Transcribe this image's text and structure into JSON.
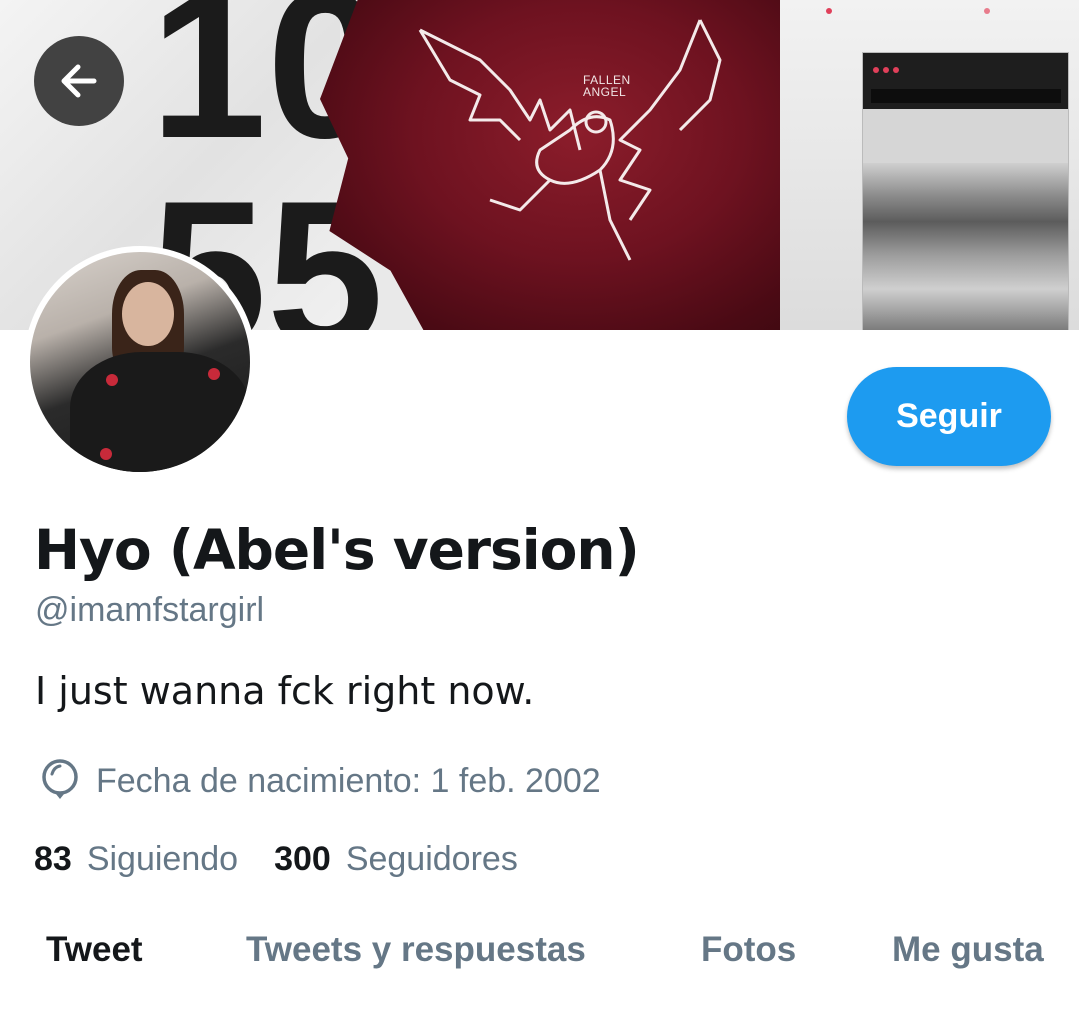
{
  "header": {
    "back_icon": "arrow-left-icon",
    "banner_text": "FALLEN ANGEL"
  },
  "profile": {
    "display_name": "Hyo (Abel's version)",
    "handle": "@imamfstargirl",
    "bio": "I just wanna fck right now.",
    "birth_icon": "balloon-icon",
    "birth_label": "Fecha de nacimiento: 1 feb. 2002",
    "follow_label": "Seguir"
  },
  "stats": {
    "following_count": "83",
    "following_label": "Siguiendo",
    "followers_count": "300",
    "followers_label": "Seguidores"
  },
  "tabs": [
    {
      "label": "Tweet",
      "active": true
    },
    {
      "label": "Tweets y respuestas",
      "active": false
    },
    {
      "label": "Fotos",
      "active": false
    },
    {
      "label": "Me gusta",
      "active": false
    }
  ],
  "colors": {
    "accent": "#1d9bf0",
    "secondary_text": "#657786",
    "primary_text": "#14171a"
  }
}
